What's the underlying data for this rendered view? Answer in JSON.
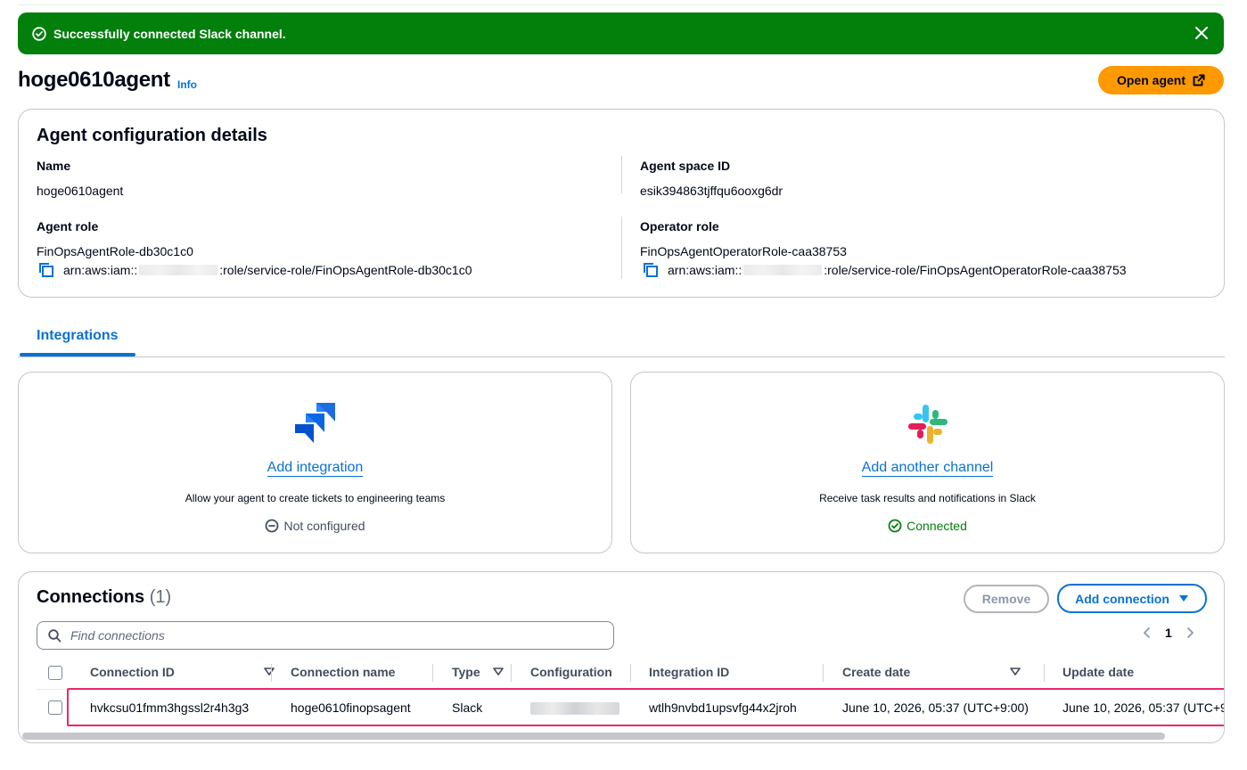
{
  "flash": {
    "message": "Successfully connected Slack channel.",
    "color": "#037f0c"
  },
  "header": {
    "title": "hoge0610agent",
    "info_label": "Info",
    "open_agent_label": "Open agent"
  },
  "config": {
    "heading": "Agent configuration details",
    "name_label": "Name",
    "name_value": "hoge0610agent",
    "space_id_label": "Agent space ID",
    "space_id_value": "esik394863tjffqu6ooxg6dr",
    "agent_role_label": "Agent role",
    "agent_role_value": "FinOpsAgentRole-db30c1c0",
    "agent_role_arn_prefix": "arn:aws:iam::",
    "agent_role_arn_suffix": ":role/service-role/FinOpsAgentRole-db30c1c0",
    "operator_role_label": "Operator role",
    "operator_role_value": "FinOpsAgentOperatorRole-caa38753",
    "operator_role_arn_prefix": "arn:aws:iam::",
    "operator_role_arn_suffix": ":role/service-role/FinOpsAgentOperatorRole-caa38753"
  },
  "tabs": [
    {
      "label": "Integrations",
      "active": true
    }
  ],
  "integrations": [
    {
      "icon": "jira-icon",
      "action": "Add integration",
      "description": "Allow your agent to create tickets to engineering teams",
      "status": "Not configured",
      "status_color": "#414d5c"
    },
    {
      "icon": "slack-icon",
      "action": "Add another channel",
      "description": "Receive task results and notifications in Slack",
      "status": "Connected",
      "status_color": "#037f0c"
    }
  ],
  "connections": {
    "title": "Connections",
    "count": "(1)",
    "remove_label": "Remove",
    "add_label": "Add connection",
    "search_placeholder": "Find connections",
    "page": "1",
    "columns": {
      "connection_id": "Connection ID",
      "connection_name": "Connection name",
      "type": "Type",
      "configuration": "Configuration",
      "integration_id": "Integration ID",
      "create_date": "Create date",
      "update_date": "Update date"
    },
    "rows": [
      {
        "connection_id": "hvkcsu01fmm3hgssl2r4h3g3",
        "connection_name": "hoge0610finopsagent",
        "type": "Slack",
        "integration_id": "wtlh9nvbd1upsvfg44x2jroh",
        "create_date": "June 10, 2026, 05:37 (UTC+9:00)",
        "update_date": "June 10, 2026, 05:37 (UTC+9"
      }
    ]
  },
  "colors": {
    "accent": "#0972d3",
    "primary_button": "#ff9900",
    "row_highlight": "#e8276c"
  }
}
